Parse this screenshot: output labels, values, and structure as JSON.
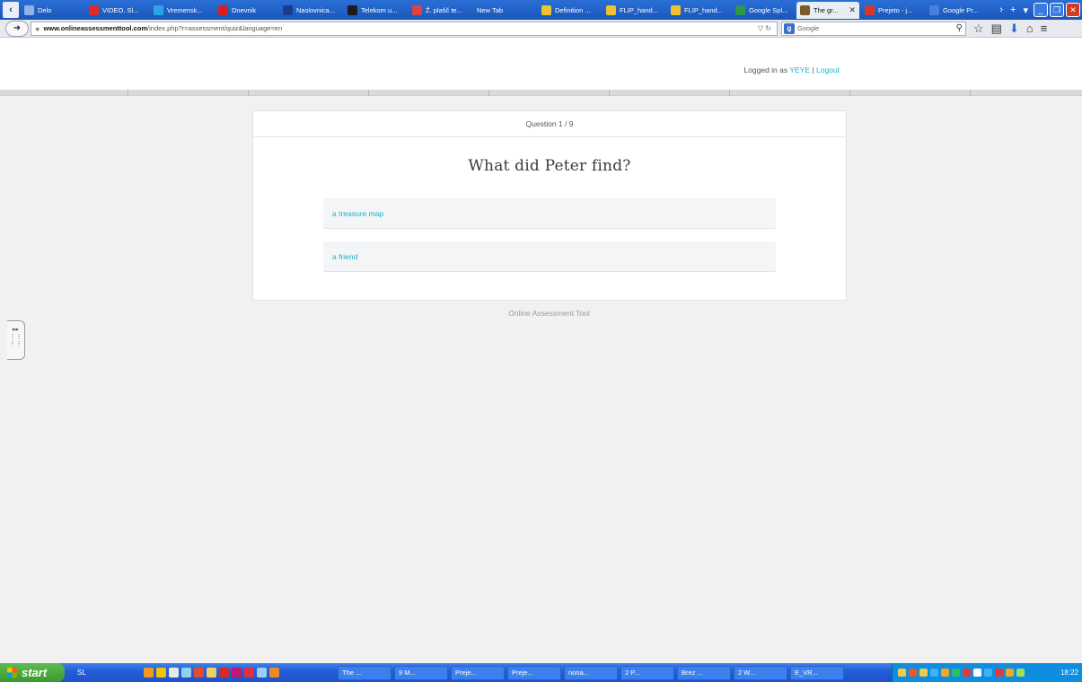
{
  "browser": {
    "tabs": [
      {
        "label": "Delo",
        "fav": "#8fb3e8",
        "active": false
      },
      {
        "label": "VIDEO. Sl...",
        "fav": "#e32a2a",
        "active": false
      },
      {
        "label": "Vremensk...",
        "fav": "#2ea3e8",
        "active": false
      },
      {
        "label": "Dnevnik",
        "fav": "#d81e1e",
        "active": false
      },
      {
        "label": "Naslovnica...",
        "fav": "#1a3c8a",
        "active": false
      },
      {
        "label": "Telekom u...",
        "fav": "#1b1b1b",
        "active": false
      },
      {
        "label": "Ž. plašč te...",
        "fav": "#e0433a",
        "active": false
      },
      {
        "label": "New Tab",
        "fav": "",
        "active": false
      },
      {
        "label": "Definition ...",
        "fav": "#f1c22f",
        "active": false
      },
      {
        "label": "FLIP_hand...",
        "fav": "#f1c22f",
        "active": false
      },
      {
        "label": "FLIP_hand...",
        "fav": "#f1c22f",
        "active": false
      },
      {
        "label": "Google Spl...",
        "fav": "#2a9a4a",
        "active": false
      },
      {
        "label": "The gr...",
        "fav": "#7a5a2a",
        "active": true
      },
      {
        "label": "Prejeto - j...",
        "fav": "#d8362c",
        "active": false
      },
      {
        "label": "Google Pr...",
        "fav": "#4a7fe0",
        "active": false
      }
    ],
    "url_host": "www.onlineassessmenttool.com",
    "url_path": "/index.php?r=assessment/quiz&language=en",
    "search_placeholder": "Google"
  },
  "page": {
    "logged_in_prefix": "Logged in as",
    "username": "YEYE",
    "separator": "|",
    "logout": "Logout",
    "question_counter": "Question 1 / 9",
    "question": "What did Peter find?",
    "answers": [
      "a treasure map",
      "a friend"
    ],
    "footer": "Online Assessment Tool"
  },
  "taskbar": {
    "start": "start",
    "language": "SL",
    "items": [
      "The ...",
      "9 M...",
      "Preje...",
      "Preje...",
      "nona...",
      "2 P...",
      "Brez ...",
      "2 W...",
      "E_VR..."
    ],
    "clock": "18:22"
  },
  "colors": {
    "accent": "#1ab3c5",
    "page_bg": "#f1f1f1"
  }
}
